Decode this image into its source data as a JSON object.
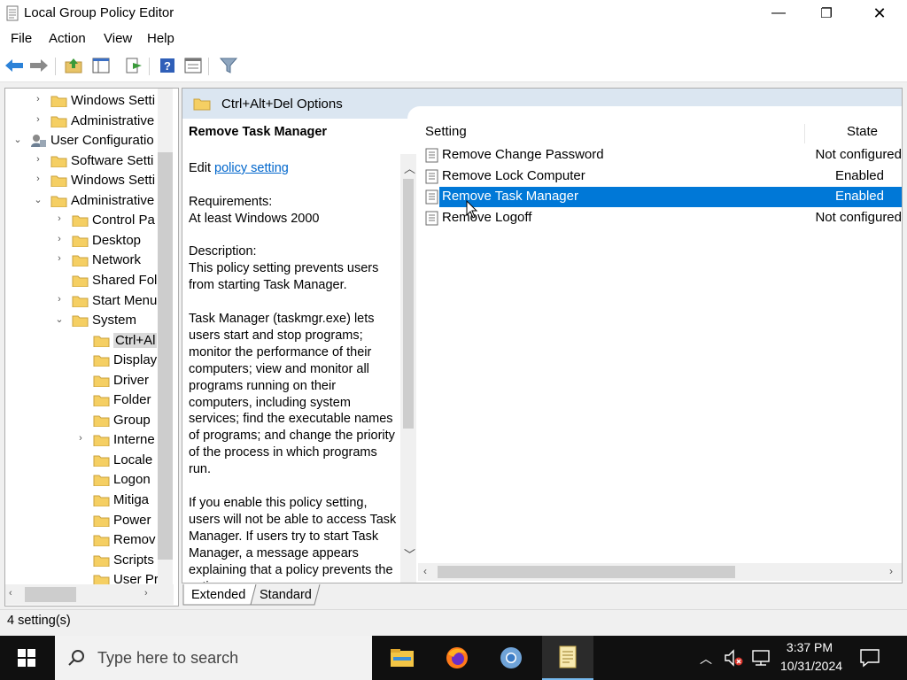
{
  "window": {
    "title": "Local Group Policy Editor",
    "min_glyph": "—",
    "max_glyph": "❐",
    "close_glyph": "✕"
  },
  "menu": [
    "File",
    "Action",
    "View",
    "Help"
  ],
  "tree": [
    {
      "label": "Windows Setti",
      "indent": 2,
      "chev": "›",
      "icon": "folder"
    },
    {
      "label": "Administrative",
      "indent": 2,
      "chev": "›",
      "icon": "folder"
    },
    {
      "label": "User Configuratio",
      "indent": 1,
      "chev": "⌄",
      "icon": "user"
    },
    {
      "label": "Software Setti",
      "indent": 2,
      "chev": "›",
      "icon": "folder"
    },
    {
      "label": "Windows Setti",
      "indent": 2,
      "chev": "›",
      "icon": "folder"
    },
    {
      "label": "Administrative",
      "indent": 2,
      "chev": "⌄",
      "icon": "folder"
    },
    {
      "label": "Control Pa",
      "indent": 3,
      "chev": "›",
      "icon": "folder"
    },
    {
      "label": "Desktop",
      "indent": 3,
      "chev": "›",
      "icon": "folder"
    },
    {
      "label": "Network",
      "indent": 3,
      "chev": "›",
      "icon": "folder"
    },
    {
      "label": "Shared Fol",
      "indent": 3,
      "chev": "",
      "icon": "folder"
    },
    {
      "label": "Start Menu",
      "indent": 3,
      "chev": "›",
      "icon": "folder"
    },
    {
      "label": "System",
      "indent": 3,
      "chev": "⌄",
      "icon": "folder"
    },
    {
      "label": "Ctrl+Al",
      "indent": 4,
      "chev": "",
      "icon": "folder",
      "selected": true
    },
    {
      "label": "Display",
      "indent": 4,
      "chev": "",
      "icon": "folder"
    },
    {
      "label": "Driver",
      "indent": 4,
      "chev": "",
      "icon": "folder"
    },
    {
      "label": "Folder",
      "indent": 4,
      "chev": "",
      "icon": "folder"
    },
    {
      "label": "Group",
      "indent": 4,
      "chev": "",
      "icon": "folder"
    },
    {
      "label": "Interne",
      "indent": 4,
      "chev": "›",
      "icon": "folder"
    },
    {
      "label": "Locale",
      "indent": 4,
      "chev": "",
      "icon": "folder"
    },
    {
      "label": "Logon",
      "indent": 4,
      "chev": "",
      "icon": "folder"
    },
    {
      "label": "Mitiga",
      "indent": 4,
      "chev": "",
      "icon": "folder"
    },
    {
      "label": "Power",
      "indent": 4,
      "chev": "",
      "icon": "folder"
    },
    {
      "label": "Remov",
      "indent": 4,
      "chev": "",
      "icon": "folder"
    },
    {
      "label": "Scripts",
      "indent": 4,
      "chev": "",
      "icon": "folder"
    },
    {
      "label": "User Pr",
      "indent": 4,
      "chev": "",
      "icon": "folder"
    }
  ],
  "right_header": {
    "title": "Ctrl+Alt+Del Options"
  },
  "description": {
    "heading": "Remove Task Manager",
    "edit_prefix": "Edit",
    "edit_link": "policy setting",
    "paragraphs": [
      "Requirements:\nAt least Windows 2000",
      "Description:\nThis policy setting prevents users from starting Task Manager.",
      "Task Manager (taskmgr.exe) lets users start and stop programs; monitor the performance of their computers; view and monitor all programs running on their computers, including system services; find the executable names of programs; and change the priority of the process in which programs run.",
      "If you enable this policy setting, users will not be able to access Task Manager. If users try to start Task Manager, a message appears explaining that a policy prevents the action."
    ]
  },
  "columns": {
    "setting": "Setting",
    "state": "State"
  },
  "settings": [
    {
      "name": "Remove Change Password",
      "state": "Not configured"
    },
    {
      "name": "Remove Lock Computer",
      "state": "Enabled"
    },
    {
      "name": "Remove Task Manager",
      "state": "Enabled",
      "selected": true
    },
    {
      "name": "Remove Logoff",
      "state": "Not configured"
    }
  ],
  "tabs": [
    "Extended",
    "Standard"
  ],
  "status": "4 setting(s)",
  "taskbar": {
    "search_placeholder": "Type here to search",
    "time": "3:37 PM",
    "date": "10/31/2024"
  },
  "colors": {
    "selection": "#0078d7",
    "header_band": "#dbe6f1",
    "link": "#0066cc",
    "taskbar": "#101010"
  }
}
